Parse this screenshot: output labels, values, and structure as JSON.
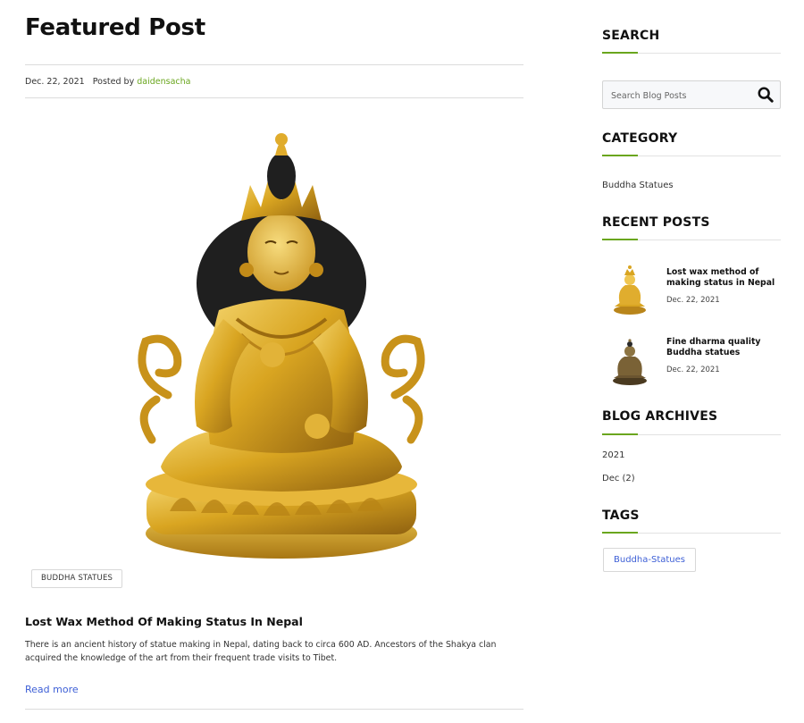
{
  "main": {
    "title": "Featured Post",
    "post": {
      "date": "Dec. 22, 2021",
      "posted_by_label": "Posted by",
      "author": "daidensacha",
      "category_badge": "BUDDHA STATUES",
      "title": "Lost Wax Method Of Making Status In Nepal",
      "excerpt": "There is an ancient history of statue making in Nepal, dating back to circa 600 AD. Ancestors of the Shakya clan acquired the knowledge of the art from their frequent trade visits to Tibet.",
      "read_more": "Read more"
    }
  },
  "sidebar": {
    "search": {
      "heading": "SEARCH",
      "placeholder": "Search Blog Posts"
    },
    "category": {
      "heading": "CATEGORY",
      "items": [
        "Buddha Statues"
      ]
    },
    "recent_posts": {
      "heading": "RECENT POSTS",
      "items": [
        {
          "title": "Lost wax method of making status in Nepal",
          "date": "Dec. 22, 2021"
        },
        {
          "title": "Fine dharma quality Buddha statues",
          "date": "Dec. 22, 2021"
        }
      ]
    },
    "archives": {
      "heading": "BLOG ARCHIVES",
      "year": "2021",
      "month": "Dec (2)"
    },
    "tags": {
      "heading": "TAGS",
      "items": [
        "Buddha-Statues"
      ]
    }
  },
  "colors": {
    "accent_green": "#6aa61e",
    "link_blue": "#3d5fd6",
    "gold": "#d4a017"
  },
  "icons": {
    "search": "search-icon"
  }
}
